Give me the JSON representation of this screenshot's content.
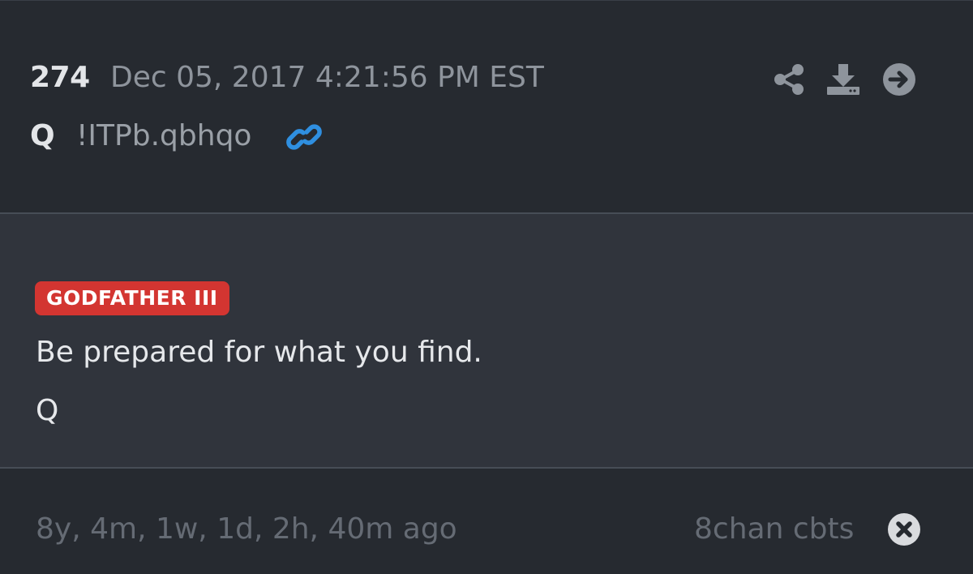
{
  "post": {
    "number": "274",
    "timestamp": "Dec 05, 2017 4:21:56 PM EST",
    "author": "Q",
    "tripcode": "!ITPb.qbhqo"
  },
  "actions": {
    "share_icon": "share-icon",
    "download_icon": "download-icon",
    "goto_icon": "arrow-right-circle-icon"
  },
  "content": {
    "badge": "GODFATHER III",
    "message": "Be prepared for what you find.",
    "signature": "Q"
  },
  "footer": {
    "elapsed": "8y, 4m, 1w, 1d, 2h, 40m ago",
    "source": "8chan cbts"
  },
  "colors": {
    "background": "#262a30",
    "body_background": "#30343c",
    "badge": "#d33531",
    "link": "#2f8fe0",
    "icon": "#8e949c"
  }
}
